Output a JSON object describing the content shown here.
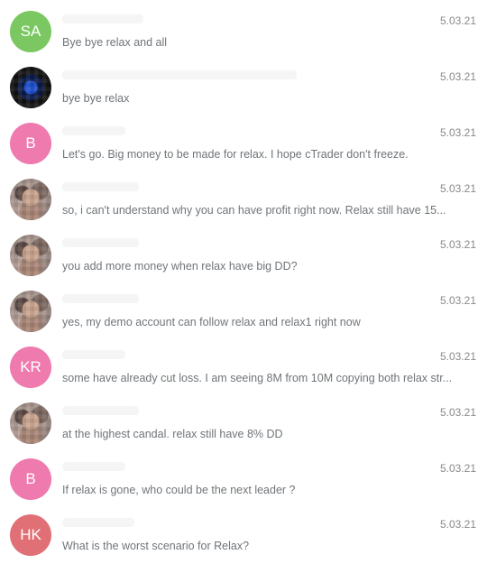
{
  "chats": [
    {
      "initials": "SA",
      "avatar_type": "initials",
      "avatar_color": "#7bc862",
      "date": "5.03.21",
      "preview": "Bye bye relax and all"
    },
    {
      "initials": "",
      "avatar_type": "photo",
      "avatar_color": "#111111",
      "date": "5.03.21",
      "preview": "bye bye relax"
    },
    {
      "initials": "B",
      "avatar_type": "initials",
      "avatar_color": "#ee7aae",
      "date": "5.03.21",
      "preview": "Let's go. Big money to be made for relax. I hope cTrader don't freeze."
    },
    {
      "initials": "",
      "avatar_type": "photo",
      "avatar_color": "#9a8680",
      "date": "5.03.21",
      "preview": "so, i can't understand why you can have profit right now. Relax still have 15..."
    },
    {
      "initials": "",
      "avatar_type": "photo",
      "avatar_color": "#9a8680",
      "date": "5.03.21",
      "preview": "you add more money when relax have big DD?"
    },
    {
      "initials": "",
      "avatar_type": "photo",
      "avatar_color": "#9a8680",
      "date": "5.03.21",
      "preview": "yes, my demo account can follow relax and relax1 right now"
    },
    {
      "initials": "KR",
      "avatar_type": "initials",
      "avatar_color": "#ee7aae",
      "date": "5.03.21",
      "preview": "some have already cut loss. I am seeing 8M from 10M copying both relax str..."
    },
    {
      "initials": "",
      "avatar_type": "photo",
      "avatar_color": "#9a8680",
      "date": "5.03.21",
      "preview": "at the highest candal. relax still have 8% DD"
    },
    {
      "initials": "B",
      "avatar_type": "initials",
      "avatar_color": "#ee7aae",
      "date": "5.03.21",
      "preview": "If relax is gone, who could be the next leader ?"
    },
    {
      "initials": "HK",
      "avatar_type": "initials",
      "avatar_color": "#e17076",
      "date": "5.03.21",
      "preview": "What is the worst scenario for Relax?"
    }
  ]
}
